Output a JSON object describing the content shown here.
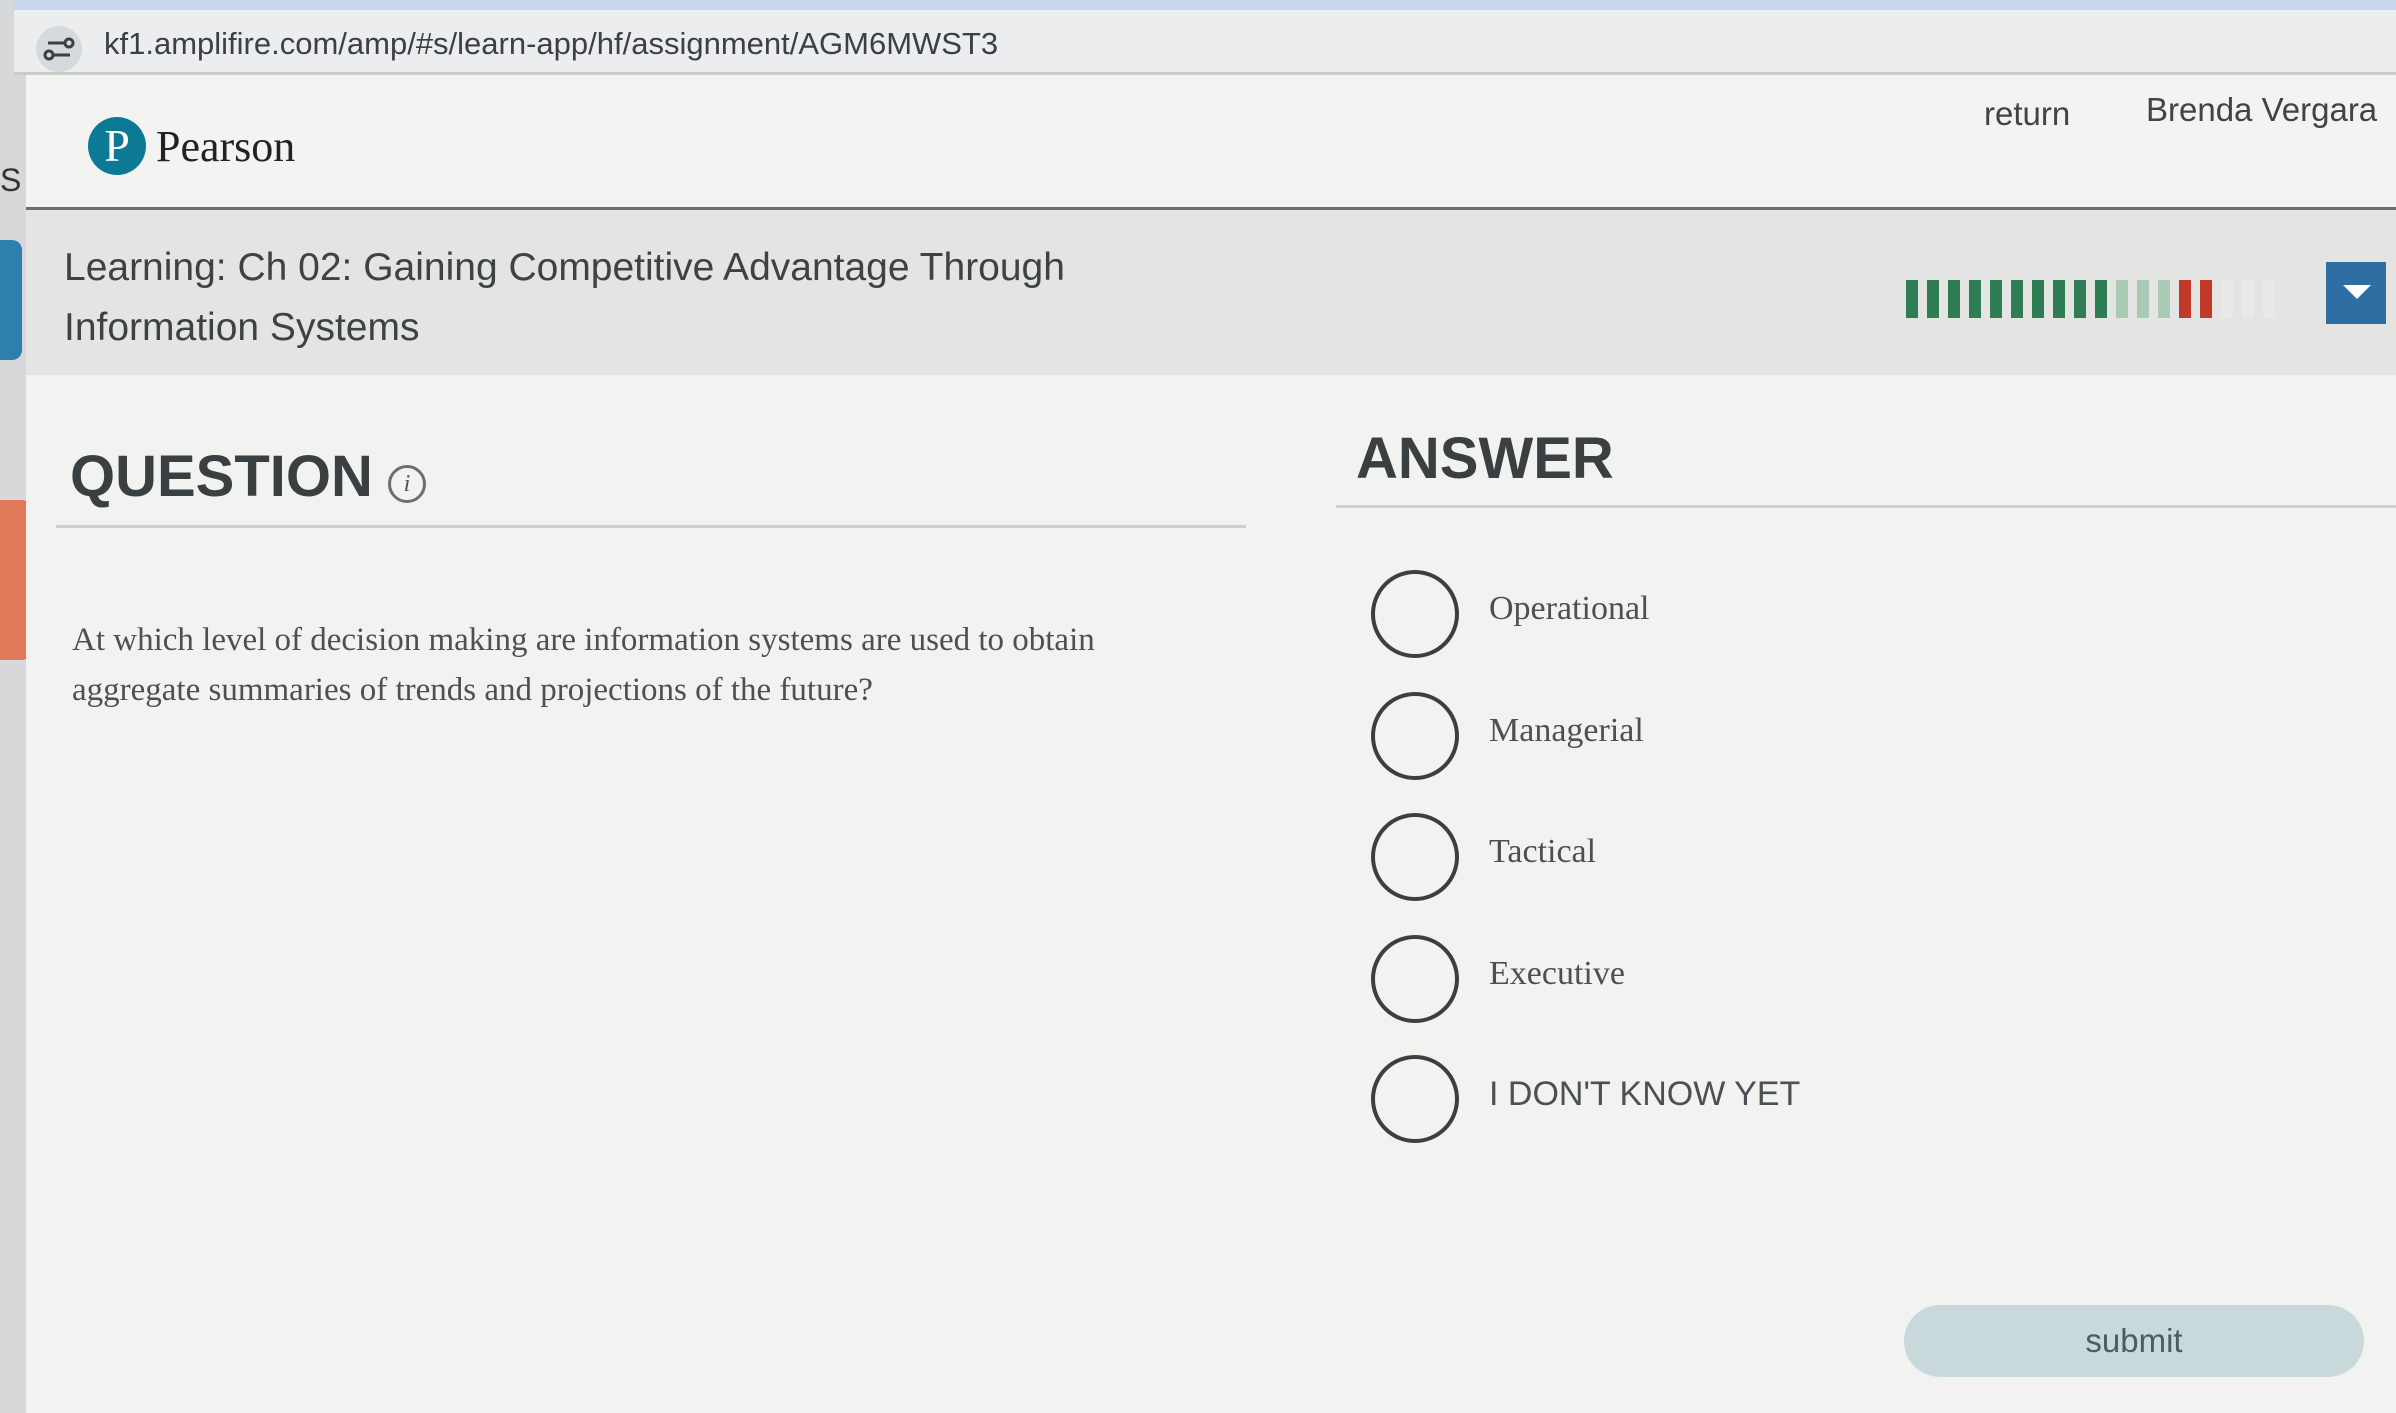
{
  "browser": {
    "url": "kf1.amplifire.com/amp/#s/learn-app/hf/assignment/AGM6MWST3"
  },
  "header": {
    "logo_letter": "P",
    "logo_text": "Pearson",
    "return_label": "return",
    "user_name": "Brenda Vergara"
  },
  "titlebar": {
    "title": "Learning: Ch 02: Gaining Competitive Advantage Through Information Systems"
  },
  "progress": {
    "segments": [
      "green",
      "green",
      "green",
      "green",
      "green",
      "green",
      "green",
      "green",
      "green",
      "green",
      "light-green",
      "light-green",
      "light-green",
      "red",
      "red",
      "empty",
      "empty",
      "empty"
    ],
    "colors": {
      "green": "#2e7d55",
      "light-green": "#a9cbb6",
      "red": "#c0392b",
      "empty": "#e9e9e8"
    }
  },
  "question": {
    "heading": "QUESTION",
    "info_symbol": "i",
    "text": "At which level of decision making are information systems are used to obtain aggregate summaries of trends and projections of the future?"
  },
  "answer": {
    "heading": "ANSWER",
    "options": [
      {
        "label": "Operational"
      },
      {
        "label": "Managerial"
      },
      {
        "label": "Tactical"
      },
      {
        "label": "Executive"
      },
      {
        "label": "I DON'T KNOW YET"
      }
    ]
  },
  "submit_label": "submit"
}
